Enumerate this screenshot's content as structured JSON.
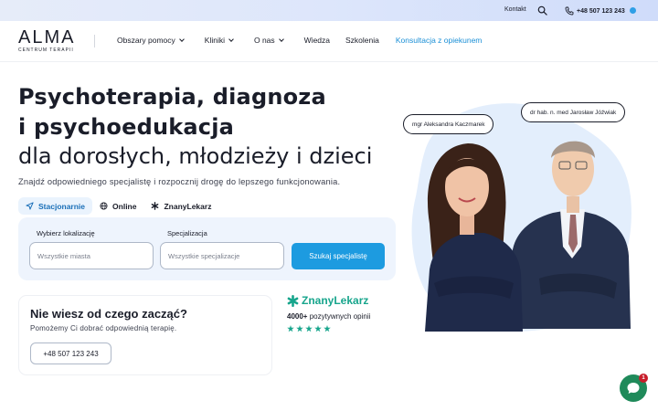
{
  "topbar": {
    "contact_label": "Kontakt",
    "phone": "+48 507 123 243"
  },
  "logo": {
    "name": "ALMA",
    "subtitle": "CENTRUM TERAPII"
  },
  "nav": {
    "items": [
      {
        "label": "Obszary pomocy",
        "dropdown": true
      },
      {
        "label": "Kliniki",
        "dropdown": true
      },
      {
        "label": "O nas",
        "dropdown": true
      },
      {
        "label": "Wiedza",
        "dropdown": false
      },
      {
        "label": "Szkolenia",
        "dropdown": false
      }
    ],
    "cta": "Konsultacja z opiekunem"
  },
  "hero": {
    "title_line1": "Psychoterapia, diagnoza",
    "title_line2": "i psychoedukacja",
    "title_line3": "dla dorosłych, młodzieży i dzieci",
    "lead": "Znajdź odpowiedniego specjalistę i rozpocznij drogę do lepszego funkcjonowania.",
    "specialist_left": "mgr Aleksandra Kaczmarek",
    "specialist_right": "dr hab. n. med Jarosław Jóźwiak"
  },
  "tabs": [
    {
      "label": "Stacjonarnie",
      "icon": "navigation-arrow-icon",
      "active": true
    },
    {
      "label": "Online",
      "icon": "globe-icon",
      "active": false
    },
    {
      "label": "ZnanyLekarz",
      "icon": "asterisk-icon",
      "active": false
    }
  ],
  "search": {
    "location_label": "Wybierz lokalizację",
    "location_value": "Wszystkie miasta",
    "specialization_label": "Specjalizacja",
    "specialization_value": "Wszystkie specjalizacje",
    "button": "Szukaj specjalistę"
  },
  "help_card": {
    "title": "Nie wiesz od czego zacząć?",
    "subtitle": "Pomożemy Ci dobrać odpowiednią terapię.",
    "phone_button": "+48 507 123 243"
  },
  "znanylekarz": {
    "brand": "ZnanyLekarz",
    "reviews_count": "4000+",
    "reviews_text": "pozytywnych opinii",
    "stars": 5
  },
  "chat": {
    "unread": "1"
  },
  "colors": {
    "accent": "#1d9be0",
    "cta_link": "#1a8fd6",
    "znany_green": "#17a58c",
    "hero_blob": "#e3eefc",
    "chat_green": "#1f8a5a",
    "badge_red": "#c81e2b"
  }
}
